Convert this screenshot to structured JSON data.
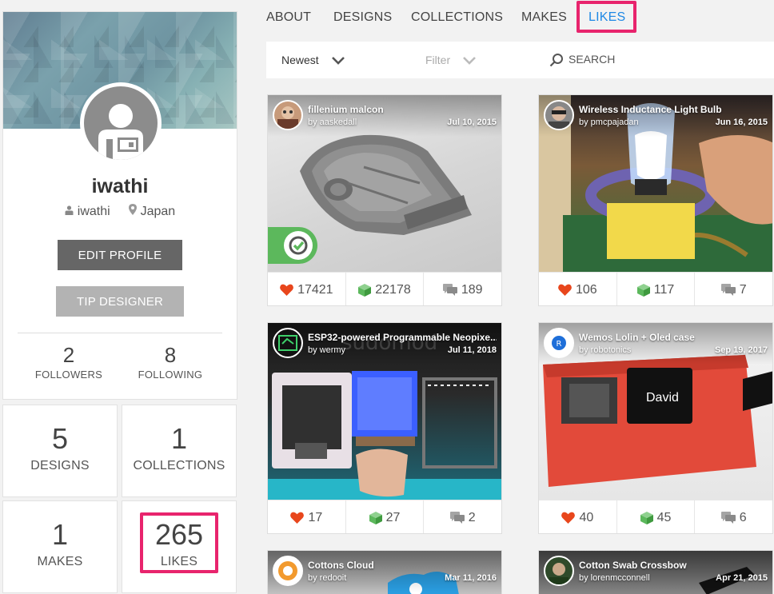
{
  "profile": {
    "username": "iwathi",
    "handle": "iwathi",
    "location": "Japan",
    "edit_label": "EDIT PROFILE",
    "tip_label": "TIP DESIGNER",
    "followers": {
      "count": "2",
      "label": "FOLLOWERS"
    },
    "following": {
      "count": "8",
      "label": "FOLLOWING"
    }
  },
  "stats": [
    {
      "count": "5",
      "label": "DESIGNS"
    },
    {
      "count": "1",
      "label": "COLLECTIONS"
    },
    {
      "count": "1",
      "label": "MAKES"
    },
    {
      "count": "265",
      "label": "LIKES"
    }
  ],
  "nav": {
    "items": [
      "ABOUT",
      "DESIGNS",
      "COLLECTIONS",
      "MAKES",
      "LIKES"
    ],
    "active": "LIKES"
  },
  "filterbar": {
    "sort": "Newest",
    "filter": "Filter",
    "search": "SEARCH"
  },
  "cards": [
    {
      "title": "fillenium malcon",
      "author": "by aaskedall",
      "date": "Jul 10, 2015",
      "likes": "17421",
      "remixes": "22178",
      "comments": "189"
    },
    {
      "title": "Wireless Inductance Light Bulb",
      "author": "by pmcpajadan",
      "date": "Jun 16, 2015",
      "likes": "106",
      "remixes": "117",
      "comments": "7"
    },
    {
      "title": "ESP32-powered Programmable Neopixe...",
      "author": "by wermy",
      "date": "Jul 11, 2018",
      "likes": "17",
      "remixes": "27",
      "comments": "2",
      "overlay": "sudomod"
    },
    {
      "title": "Wemos Lolin + Oled case",
      "author": "by robotonics",
      "date": "Sep 19, 2017",
      "likes": "40",
      "remixes": "45",
      "comments": "6",
      "screen_text": "David"
    },
    {
      "title": "Cottons Cloud",
      "author": "by redooit",
      "date": "Mar 11, 2016"
    },
    {
      "title": "Cotton Swab Crossbow",
      "author": "by lorenmcconnell",
      "date": "Apr 21, 2015"
    }
  ],
  "colors": {
    "accent": "#1e88e5",
    "highlight": "#e8246d",
    "like": "#e8461c",
    "remix": "#5cb85c",
    "comment": "#9e9e9e"
  }
}
